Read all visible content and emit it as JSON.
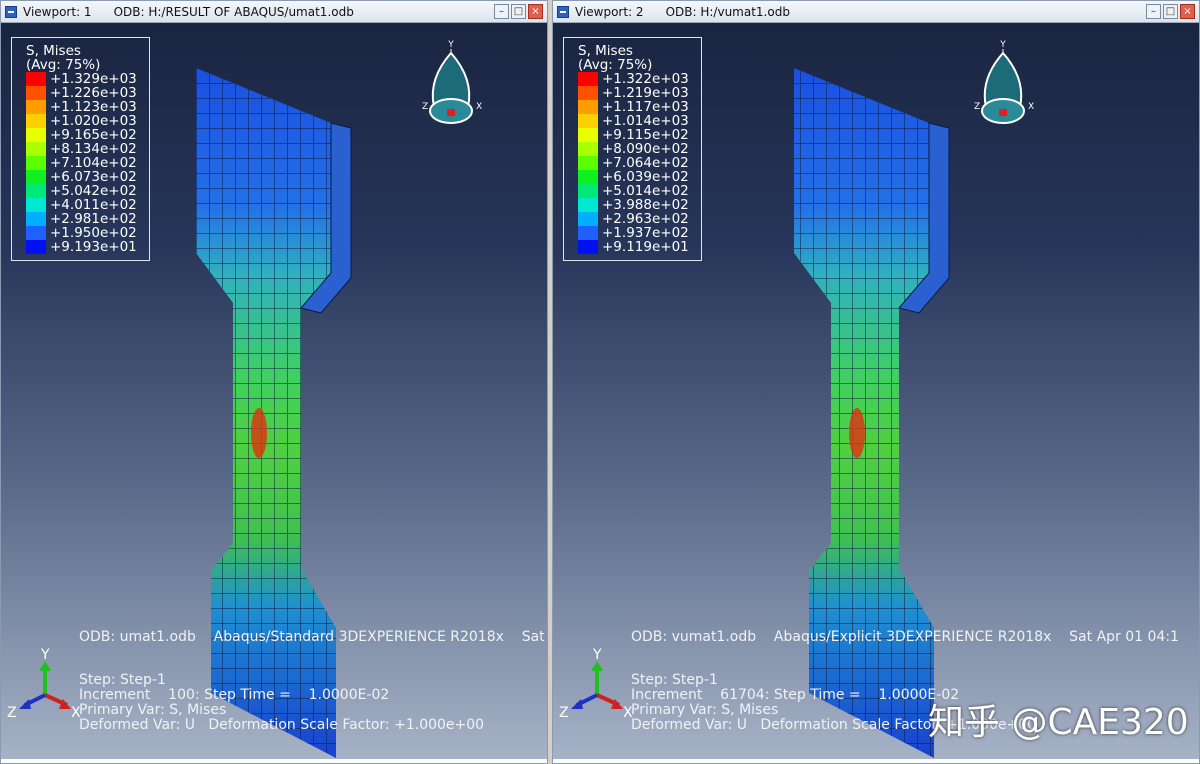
{
  "viewports": [
    {
      "title": "Viewport: 1",
      "odb_path": "ODB: H:/RESULT OF ABAQUS/umat1.odb",
      "legend": {
        "title": "S, Mises",
        "subtitle": "(Avg: 75%)",
        "values": [
          "+1.329e+03",
          "+1.226e+03",
          "+1.123e+03",
          "+1.020e+03",
          "+9.165e+02",
          "+8.134e+02",
          "+7.104e+02",
          "+6.073e+02",
          "+5.042e+02",
          "+4.011e+02",
          "+2.981e+02",
          "+1.950e+02",
          "+9.193e+01"
        ]
      },
      "info": {
        "odb": "ODB: umat1.odb    Abaqus/Standard 3DEXPERIENCE R2018x    Sat",
        "step": "Step: Step-1",
        "increment": "Increment    100: Step Time =    1.0000E-02",
        "primary": "Primary Var: S, Mises",
        "deformed": "Deformed Var: U   Deformation Scale Factor: +1.000e+00"
      }
    },
    {
      "title": "Viewport: 2",
      "odb_path": "ODB: H:/vumat1.odb",
      "legend": {
        "title": "S, Mises",
        "subtitle": "(Avg: 75%)",
        "values": [
          "+1.322e+03",
          "+1.219e+03",
          "+1.117e+03",
          "+1.014e+03",
          "+9.115e+02",
          "+8.090e+02",
          "+7.064e+02",
          "+6.039e+02",
          "+5.014e+02",
          "+3.988e+02",
          "+2.963e+02",
          "+1.937e+02",
          "+9.119e+01"
        ]
      },
      "info": {
        "odb": "ODB: vumat1.odb    Abaqus/Explicit 3DEXPERIENCE R2018x    Sat Apr 01 04:1",
        "step": "Step: Step-1",
        "increment": "Increment    61704: Step Time =    1.0000E-02",
        "primary": "Primary Var: S, Mises",
        "deformed": "Deformed Var: U   Deformation Scale Factor: +1.000e+00"
      }
    }
  ],
  "legend_colors": [
    "#ff0000",
    "#ff5000",
    "#ff9c00",
    "#ffd000",
    "#e8ff00",
    "#a8ff00",
    "#5cff00",
    "#10f020",
    "#00e878",
    "#00e8d0",
    "#00b0ff",
    "#2060ff",
    "#0010f0"
  ],
  "axes": {
    "x": "X",
    "y": "Y",
    "z": "Z"
  },
  "watermark": "知乎 @CAE320"
}
